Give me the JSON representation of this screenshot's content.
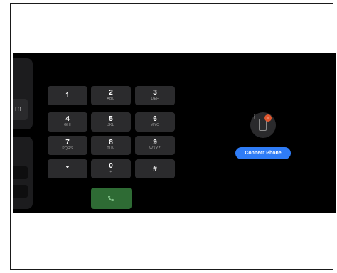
{
  "side_panel": {
    "top_card_label": "m"
  },
  "keypad": {
    "keys": [
      {
        "digit": "1",
        "letters": ""
      },
      {
        "digit": "2",
        "letters": "ABC"
      },
      {
        "digit": "3",
        "letters": "DEF"
      },
      {
        "digit": "4",
        "letters": "GHI"
      },
      {
        "digit": "5",
        "letters": "JKL"
      },
      {
        "digit": "6",
        "letters": "MNO"
      },
      {
        "digit": "7",
        "letters": "PQRS"
      },
      {
        "digit": "8",
        "letters": "TUV"
      },
      {
        "digit": "9",
        "letters": "WXYZ"
      },
      {
        "digit": "*",
        "letters": ""
      },
      {
        "digit": "0",
        "letters": "+"
      },
      {
        "digit": "#",
        "letters": ""
      }
    ]
  },
  "call_button": {
    "icon": "phone-icon",
    "color": "#2e6b34"
  },
  "connect": {
    "icon": "phone-bluetooth-icon",
    "label": "Connect Phone",
    "accent": "#2f7cf6",
    "badge_color": "#e0572f"
  }
}
